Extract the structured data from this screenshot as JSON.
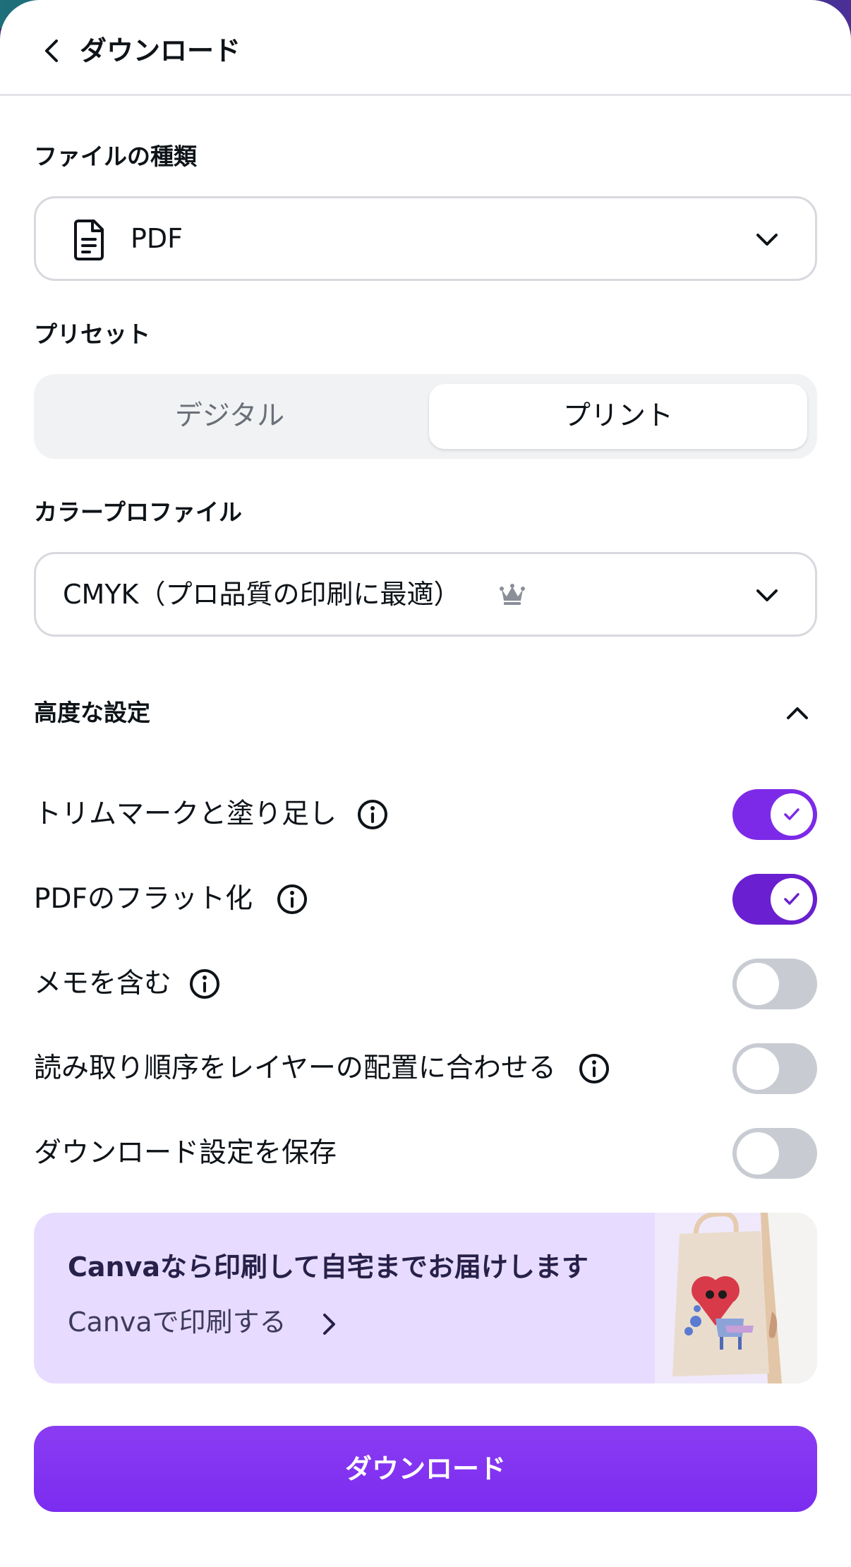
{
  "header": {
    "title": "ダウンロード",
    "back_icon": "chevron-left-icon"
  },
  "file_type": {
    "label": "ファイルの種類",
    "value": "PDF",
    "icon": "document-icon"
  },
  "preset": {
    "label": "プリセット",
    "options": [
      "デジタル",
      "プリント"
    ],
    "selected": "プリント"
  },
  "color_profile": {
    "label": "カラープロファイル",
    "value": "CMYK（プロ品質の印刷に最適）",
    "badge_icon": "crown-icon"
  },
  "advanced": {
    "label": "高度な設定",
    "expanded": true,
    "options": [
      {
        "label": "トリムマークと塗り足し",
        "info": true,
        "enabled": true
      },
      {
        "label": "PDFのフラット化",
        "info": true,
        "enabled": true
      },
      {
        "label": "メモを含む",
        "info": true,
        "enabled": false
      },
      {
        "label": "読み取り順序をレイヤーの配置に合わせる",
        "info": true,
        "enabled": false
      },
      {
        "label": "ダウンロード設定を保存",
        "info": false,
        "enabled": false
      }
    ]
  },
  "promo": {
    "title": "Canvaなら印刷して自宅までお届けします",
    "link": "Canvaで印刷する"
  },
  "download_button": {
    "label": "ダウンロード"
  },
  "colors": {
    "accent": "#7d2ae8",
    "promo_bg": "#e7dcff",
    "toggle_off": "#c8ccd2"
  }
}
